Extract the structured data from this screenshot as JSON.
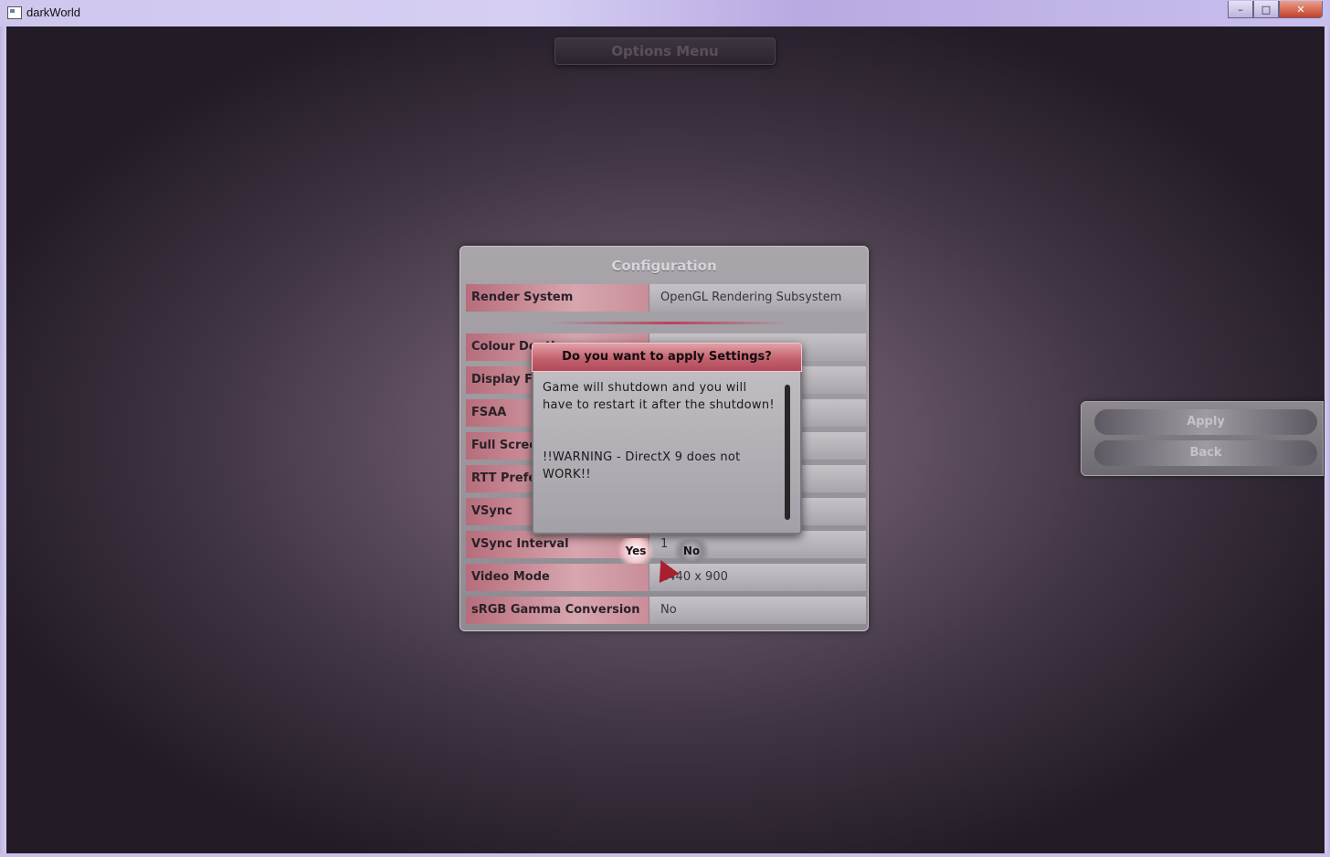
{
  "window": {
    "title": "darkWorld",
    "minimize": "–",
    "maximize": "□",
    "close": "✕"
  },
  "options_menu": {
    "title": "Options Menu"
  },
  "configuration": {
    "title": "Configuration",
    "rows": [
      {
        "label": "Render System",
        "value": "OpenGL Rendering Subsystem"
      },
      {
        "label": "Colour Depth",
        "value": ""
      },
      {
        "label": "Display Frequency",
        "value": ""
      },
      {
        "label": "FSAA",
        "value": ""
      },
      {
        "label": "Full Screen",
        "value": ""
      },
      {
        "label": "RTT Preferred Mode",
        "value": ""
      },
      {
        "label": "VSync",
        "value": ""
      },
      {
        "label": "VSync Interval",
        "value": "1"
      },
      {
        "label": "Video Mode",
        "value": "1440 x 900"
      },
      {
        "label": "sRGB Gamma Conversion",
        "value": "No"
      }
    ]
  },
  "side_buttons": {
    "apply": "Apply",
    "back": "Back"
  },
  "dialog": {
    "title": "Do you want to apply Settings?",
    "line1": "Game will shutdown and you will have to restart it after the shutdown!",
    "line2": "!!WARNING - DirectX 9 does not WORK!!",
    "yes": "Yes",
    "no": "No"
  }
}
